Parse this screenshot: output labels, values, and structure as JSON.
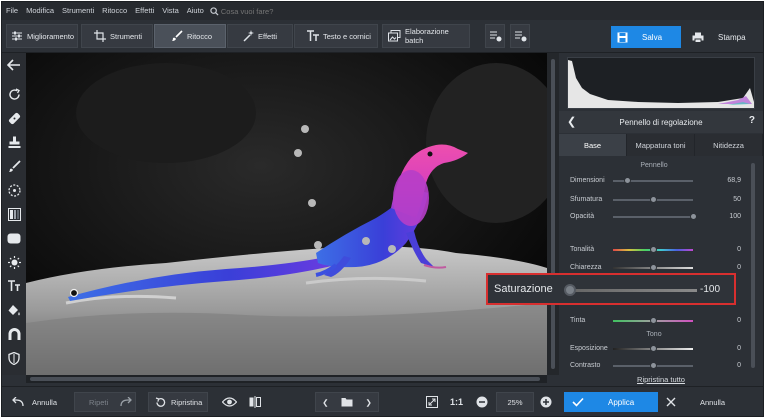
{
  "menu": [
    "File",
    "Modifica",
    "Strumenti",
    "Ritocco",
    "Effetti",
    "Vista",
    "Aiuto"
  ],
  "search": {
    "placeholder": "Cosa vuoi fare?",
    "icon": "search-icon"
  },
  "tabs": [
    {
      "label": "Miglioramento",
      "icon": "sliders-icon",
      "active": false
    },
    {
      "label": "Strumenti",
      "icon": "crop-icon",
      "active": false
    },
    {
      "label": "Ritocco",
      "icon": "brush-icon",
      "active": true
    },
    {
      "label": "Effetti",
      "icon": "magic-wand-icon",
      "active": false
    },
    {
      "label": "Testo e cornici",
      "icon": "text-icon",
      "active": false
    },
    {
      "label": "Elaborazione batch",
      "icon": "batch-icon",
      "active": false
    }
  ],
  "actions": {
    "save_label": "Salva",
    "print_label": "Stampa"
  },
  "colors": {
    "accent": "#1e88e5",
    "highlight": "#d82f2f",
    "panel": "#2c3036"
  },
  "panel": {
    "title": "Pennello di regolazione",
    "help": "?",
    "tabs": [
      {
        "label": "Base",
        "active": true
      },
      {
        "label": "Mappatura toni",
        "active": false
      },
      {
        "label": "Nitidezza",
        "active": false
      }
    ],
    "brush_section": "Pennello",
    "brush_rows": [
      {
        "label": "Dimensioni",
        "value": "68,9",
        "fraction": 0.18
      },
      {
        "label": "Sfumatura",
        "value": "50",
        "fraction": 0.5
      },
      {
        "label": "Opacità",
        "value": "100",
        "fraction": 1.0
      }
    ],
    "color_rows": [
      {
        "label": "Tonalità",
        "value": "0",
        "fraction": 0.5
      },
      {
        "label": "Chiarezza",
        "value": "0",
        "fraction": 0.5
      },
      {
        "label": "Tinta",
        "value": "0",
        "fraction": 0.5
      }
    ],
    "tone_section": "Tono",
    "tone_rows": [
      {
        "label": "Esposizione",
        "value": "0",
        "fraction": 0.5
      },
      {
        "label": "Contrasto",
        "value": "0",
        "fraction": 0.5
      }
    ],
    "reset_all": "Ripristina tutto"
  },
  "callout": {
    "label": "Saturazione",
    "value": "-100",
    "fraction": 0.0
  },
  "bottom": {
    "undo": "Annulla",
    "redo": "Ripeti",
    "restore": "Ripristina",
    "zoom_fit": "1:1",
    "zoom": "25%",
    "apply": "Applica",
    "cancel": "Annulla"
  }
}
